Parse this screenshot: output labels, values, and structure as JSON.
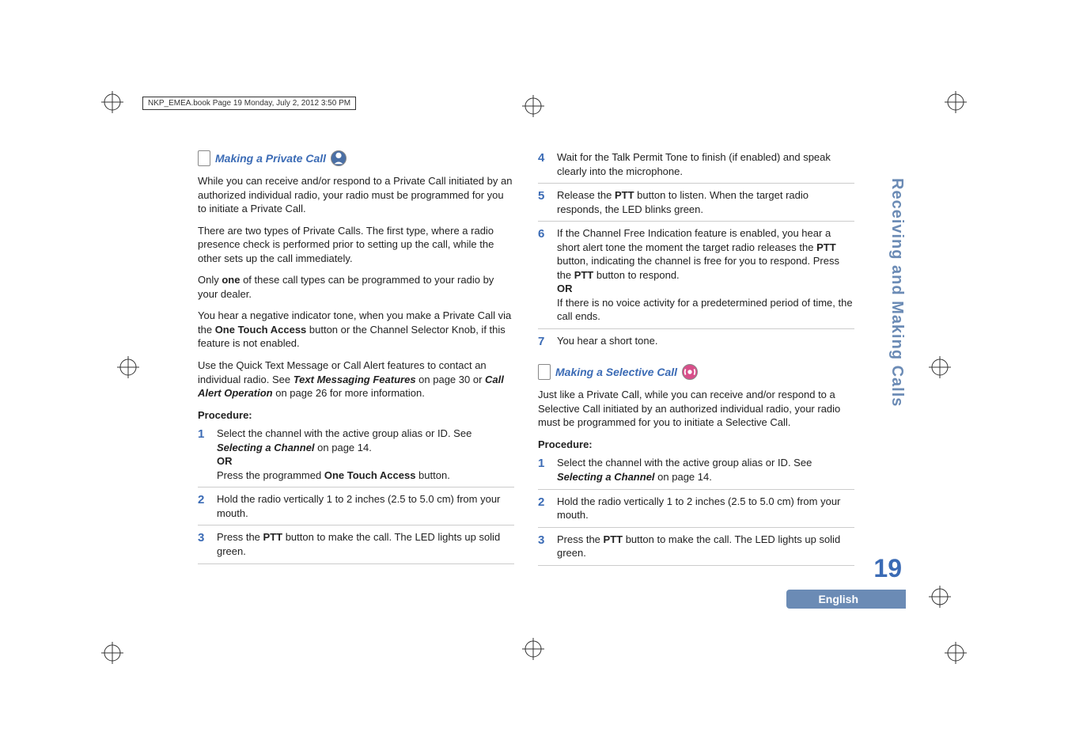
{
  "header_line": "NKP_EMEA.book  Page 19  Monday, July 2, 2012  3:50 PM",
  "side_tab": "Receiving and Making Calls",
  "page_num": "19",
  "english": "English",
  "left": {
    "heading": "Making a Private Call",
    "p1": "While you can receive and/or respond to a Private Call initiated by an authorized individual radio, your radio must be programmed for you to initiate a Private Call.",
    "p2a": "There are two types of Private Calls. The first type, where a radio presence check is performed prior to setting up the call, while the other sets up the call immediately.",
    "p3_pre": "Only ",
    "p3_bold": "one",
    "p3_post": " of these call types can be programmed to your radio by your dealer.",
    "p4_pre": "You hear a negative indicator tone, when you make a Private Call via the ",
    "p4_bold": "One Touch Access",
    "p4_post": " button or the Channel Selector Knob, if this feature is not enabled.",
    "p5_pre": "Use the Quick Text Message or Call Alert features to contact an individual radio. See ",
    "p5_i1": "Text Messaging Features",
    "p5_mid": " on page 30 or ",
    "p5_i2": "Call Alert Operation",
    "p5_post": " on page 26 for more information.",
    "proc": "Procedure:",
    "s1_pre": "Select the channel with the active group alias or ID. See ",
    "s1_i": "Selecting a Channel",
    "s1_post": " on page 14.",
    "s1_or": "OR",
    "s1b_pre": "Press the programmed ",
    "s1b_bold": "One Touch Access",
    "s1b_post": " button.",
    "s2": "Hold the radio vertically 1 to 2 inches (2.5 to 5.0 cm) from your mouth.",
    "s3_pre": "Press the ",
    "s3_bold": "PTT",
    "s3_post": " button to make the call. The LED lights up solid green."
  },
  "right": {
    "s4": "Wait for the Talk Permit Tone to finish (if enabled) and speak clearly into the microphone.",
    "s5_pre": "Release the ",
    "s5_bold": "PTT",
    "s5_post": " button to listen. When the target radio responds, the LED blinks green.",
    "s6_pre": "If the Channel Free Indication feature is enabled, you hear a short alert tone the moment the target radio releases the ",
    "s6_bold1": "PTT",
    "s6_mid": " button, indicating the channel is free for you to respond. Press the ",
    "s6_bold2": "PTT",
    "s6_post": " button to respond.",
    "s6_or": "OR",
    "s6b": "If there is no voice activity for a predetermined period of time, the call ends.",
    "s7": "You hear a short tone.",
    "heading2": "Making a Selective Call",
    "p1": "Just like a Private Call, while you can receive and/or respond to a Selective Call initiated by an authorized individual radio, your radio must be programmed for you to initiate a Selective Call.",
    "proc": "Procedure:",
    "s1_pre": "Select the channel with the active group alias or ID. See ",
    "s1_i": "Selecting a Channel",
    "s1_post": " on page 14.",
    "s2": "Hold the radio vertically 1 to 2 inches (2.5 to 5.0 cm) from your mouth.",
    "s3_pre": "Press the ",
    "s3_bold": "PTT",
    "s3_post": " button to make the call. The LED lights up solid green."
  }
}
